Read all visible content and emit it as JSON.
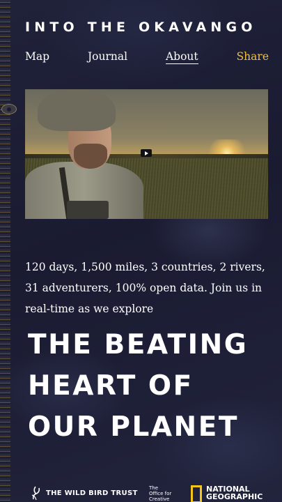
{
  "header": {
    "title": "INTO THE OKAVANGO"
  },
  "nav": {
    "items": [
      {
        "label": "Map"
      },
      {
        "label": "Journal"
      },
      {
        "label": "About",
        "active": true
      },
      {
        "label": "Share"
      }
    ]
  },
  "video": {
    "play_icon": "play-icon"
  },
  "intro": {
    "text": "120 days, 1,500 miles, 3 countries, 2 rivers, 31 adventurers, 100% open data. Join us in real-time as we explore"
  },
  "headline": {
    "lines": [
      "THE BEATING",
      "HEART OF",
      "OUR PLANET"
    ]
  },
  "partners": {
    "wild_bird_trust": "THE WILD BIRD TRUST",
    "office_creative_line1": "The",
    "office_creative_line2": "Office for",
    "office_creative_line3": "Creative",
    "natgeo_line1": "NATIONAL",
    "natgeo_line2": "GEOGRAPHIC"
  },
  "colors": {
    "background": "#1a1b33",
    "accent_share": "#f0c040",
    "natgeo_yellow": "#f5c518"
  }
}
